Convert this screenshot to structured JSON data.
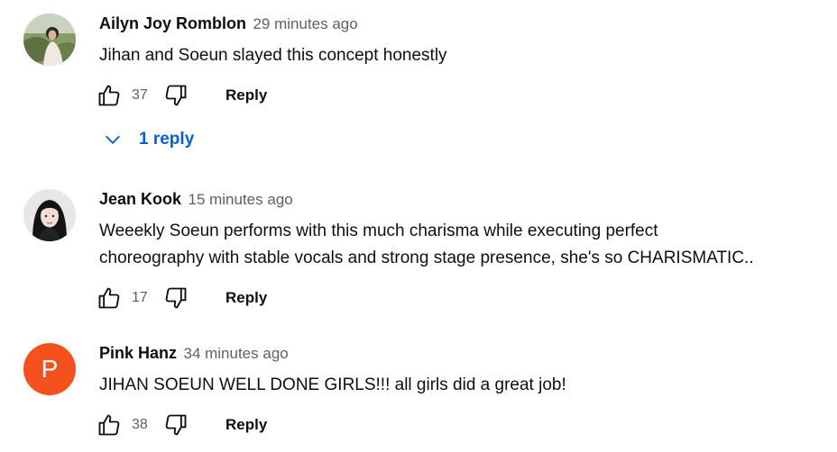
{
  "comments": [
    {
      "author": "Ailyn Joy Romblon",
      "time": "29 minutes ago",
      "text": "Jihan and Soeun slayed this concept honestly",
      "likes": "37",
      "reply_label": "Reply",
      "replies_label": "1 reply"
    },
    {
      "author": "Jean Kook",
      "time": "15 minutes ago",
      "text_line1": "Weeekly Soeun performs with this much charisma while executing perfect",
      "text_line2": "choreography with stable vocals and strong stage presence, she's so CHARISMATIC..",
      "likes": "17",
      "reply_label": "Reply"
    },
    {
      "author": "Pink Hanz",
      "time": "34 minutes ago",
      "text": "JIHAN SOEUN WELL DONE GIRLS!!! all girls did a great job!",
      "likes": "38",
      "reply_label": "Reply",
      "avatar_letter": "P",
      "avatar_color": "#f4511e"
    }
  ],
  "icons": {
    "like": "thumbs-up-icon",
    "dislike": "thumbs-down-icon",
    "expand": "chevron-down-icon"
  },
  "colors": {
    "link": "#065fd4",
    "secondary_text": "#606060"
  }
}
